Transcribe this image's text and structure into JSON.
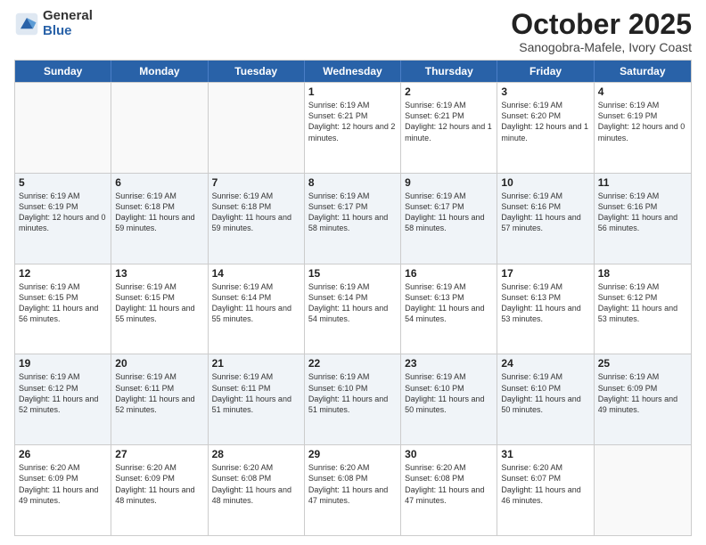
{
  "logo": {
    "general": "General",
    "blue": "Blue"
  },
  "title": "October 2025",
  "subtitle": "Sanogobra-Mafele, Ivory Coast",
  "weekdays": [
    "Sunday",
    "Monday",
    "Tuesday",
    "Wednesday",
    "Thursday",
    "Friday",
    "Saturday"
  ],
  "weeks": [
    [
      {
        "day": "",
        "info": ""
      },
      {
        "day": "",
        "info": ""
      },
      {
        "day": "",
        "info": ""
      },
      {
        "day": "1",
        "info": "Sunrise: 6:19 AM\nSunset: 6:21 PM\nDaylight: 12 hours and 2 minutes."
      },
      {
        "day": "2",
        "info": "Sunrise: 6:19 AM\nSunset: 6:21 PM\nDaylight: 12 hours and 1 minute."
      },
      {
        "day": "3",
        "info": "Sunrise: 6:19 AM\nSunset: 6:20 PM\nDaylight: 12 hours and 1 minute."
      },
      {
        "day": "4",
        "info": "Sunrise: 6:19 AM\nSunset: 6:19 PM\nDaylight: 12 hours and 0 minutes."
      }
    ],
    [
      {
        "day": "5",
        "info": "Sunrise: 6:19 AM\nSunset: 6:19 PM\nDaylight: 12 hours and 0 minutes."
      },
      {
        "day": "6",
        "info": "Sunrise: 6:19 AM\nSunset: 6:18 PM\nDaylight: 11 hours and 59 minutes."
      },
      {
        "day": "7",
        "info": "Sunrise: 6:19 AM\nSunset: 6:18 PM\nDaylight: 11 hours and 59 minutes."
      },
      {
        "day": "8",
        "info": "Sunrise: 6:19 AM\nSunset: 6:17 PM\nDaylight: 11 hours and 58 minutes."
      },
      {
        "day": "9",
        "info": "Sunrise: 6:19 AM\nSunset: 6:17 PM\nDaylight: 11 hours and 58 minutes."
      },
      {
        "day": "10",
        "info": "Sunrise: 6:19 AM\nSunset: 6:16 PM\nDaylight: 11 hours and 57 minutes."
      },
      {
        "day": "11",
        "info": "Sunrise: 6:19 AM\nSunset: 6:16 PM\nDaylight: 11 hours and 56 minutes."
      }
    ],
    [
      {
        "day": "12",
        "info": "Sunrise: 6:19 AM\nSunset: 6:15 PM\nDaylight: 11 hours and 56 minutes."
      },
      {
        "day": "13",
        "info": "Sunrise: 6:19 AM\nSunset: 6:15 PM\nDaylight: 11 hours and 55 minutes."
      },
      {
        "day": "14",
        "info": "Sunrise: 6:19 AM\nSunset: 6:14 PM\nDaylight: 11 hours and 55 minutes."
      },
      {
        "day": "15",
        "info": "Sunrise: 6:19 AM\nSunset: 6:14 PM\nDaylight: 11 hours and 54 minutes."
      },
      {
        "day": "16",
        "info": "Sunrise: 6:19 AM\nSunset: 6:13 PM\nDaylight: 11 hours and 54 minutes."
      },
      {
        "day": "17",
        "info": "Sunrise: 6:19 AM\nSunset: 6:13 PM\nDaylight: 11 hours and 53 minutes."
      },
      {
        "day": "18",
        "info": "Sunrise: 6:19 AM\nSunset: 6:12 PM\nDaylight: 11 hours and 53 minutes."
      }
    ],
    [
      {
        "day": "19",
        "info": "Sunrise: 6:19 AM\nSunset: 6:12 PM\nDaylight: 11 hours and 52 minutes."
      },
      {
        "day": "20",
        "info": "Sunrise: 6:19 AM\nSunset: 6:11 PM\nDaylight: 11 hours and 52 minutes."
      },
      {
        "day": "21",
        "info": "Sunrise: 6:19 AM\nSunset: 6:11 PM\nDaylight: 11 hours and 51 minutes."
      },
      {
        "day": "22",
        "info": "Sunrise: 6:19 AM\nSunset: 6:10 PM\nDaylight: 11 hours and 51 minutes."
      },
      {
        "day": "23",
        "info": "Sunrise: 6:19 AM\nSunset: 6:10 PM\nDaylight: 11 hours and 50 minutes."
      },
      {
        "day": "24",
        "info": "Sunrise: 6:19 AM\nSunset: 6:10 PM\nDaylight: 11 hours and 50 minutes."
      },
      {
        "day": "25",
        "info": "Sunrise: 6:19 AM\nSunset: 6:09 PM\nDaylight: 11 hours and 49 minutes."
      }
    ],
    [
      {
        "day": "26",
        "info": "Sunrise: 6:20 AM\nSunset: 6:09 PM\nDaylight: 11 hours and 49 minutes."
      },
      {
        "day": "27",
        "info": "Sunrise: 6:20 AM\nSunset: 6:09 PM\nDaylight: 11 hours and 48 minutes."
      },
      {
        "day": "28",
        "info": "Sunrise: 6:20 AM\nSunset: 6:08 PM\nDaylight: 11 hours and 48 minutes."
      },
      {
        "day": "29",
        "info": "Sunrise: 6:20 AM\nSunset: 6:08 PM\nDaylight: 11 hours and 47 minutes."
      },
      {
        "day": "30",
        "info": "Sunrise: 6:20 AM\nSunset: 6:08 PM\nDaylight: 11 hours and 47 minutes."
      },
      {
        "day": "31",
        "info": "Sunrise: 6:20 AM\nSunset: 6:07 PM\nDaylight: 11 hours and 46 minutes."
      },
      {
        "day": "",
        "info": ""
      }
    ]
  ]
}
